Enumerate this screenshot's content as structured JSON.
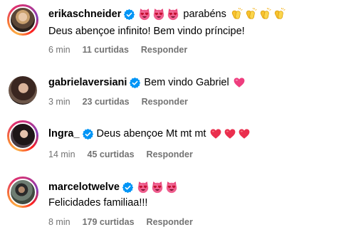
{
  "comments": [
    {
      "username": "erikaschneider",
      "verified": true,
      "has_story": true,
      "line1": {
        "emojis_before": [
          "heart-eyes-cat",
          "heart-eyes-cat",
          "heart-eyes-cat"
        ],
        "text": "parabéns",
        "emojis_after": [
          "clapping-hands",
          "clapping-hands",
          "clapping-hands",
          "clapping-hands"
        ]
      },
      "line2": "Deus abençoe infinito! Bem vindo príncipe!",
      "time": "6 min",
      "likes": "11 curtidas",
      "reply": "Responder"
    },
    {
      "username": "gabrielaversiani",
      "verified": true,
      "has_story": false,
      "line1": {
        "text": "Bem vindo Gabriel",
        "emojis_after": [
          "pink-heart"
        ]
      },
      "time": "3 min",
      "likes": "23 curtidas",
      "reply": "Responder"
    },
    {
      "username": "lngra_",
      "verified": true,
      "has_story": true,
      "line1": {
        "text": "Deus abençoe Mt mt mt",
        "emojis_after": [
          "red-heart",
          "red-heart",
          "red-heart"
        ]
      },
      "time": "14 min",
      "likes": "45 curtidas",
      "reply": "Responder"
    },
    {
      "username": "marcelotwelve",
      "verified": true,
      "has_story": true,
      "line1": {
        "emojis_after": [
          "heart-eyes-cat",
          "heart-eyes-cat",
          "heart-eyes-cat"
        ]
      },
      "line2": "Felicidades familiaa!!!",
      "time": "8 min",
      "likes": "179 curtidas",
      "reply": "Responder"
    }
  ],
  "colors": {
    "verified_badge": "#0095f6",
    "meta_text": "#737373",
    "text": "#000000",
    "background": "#ffffff"
  }
}
